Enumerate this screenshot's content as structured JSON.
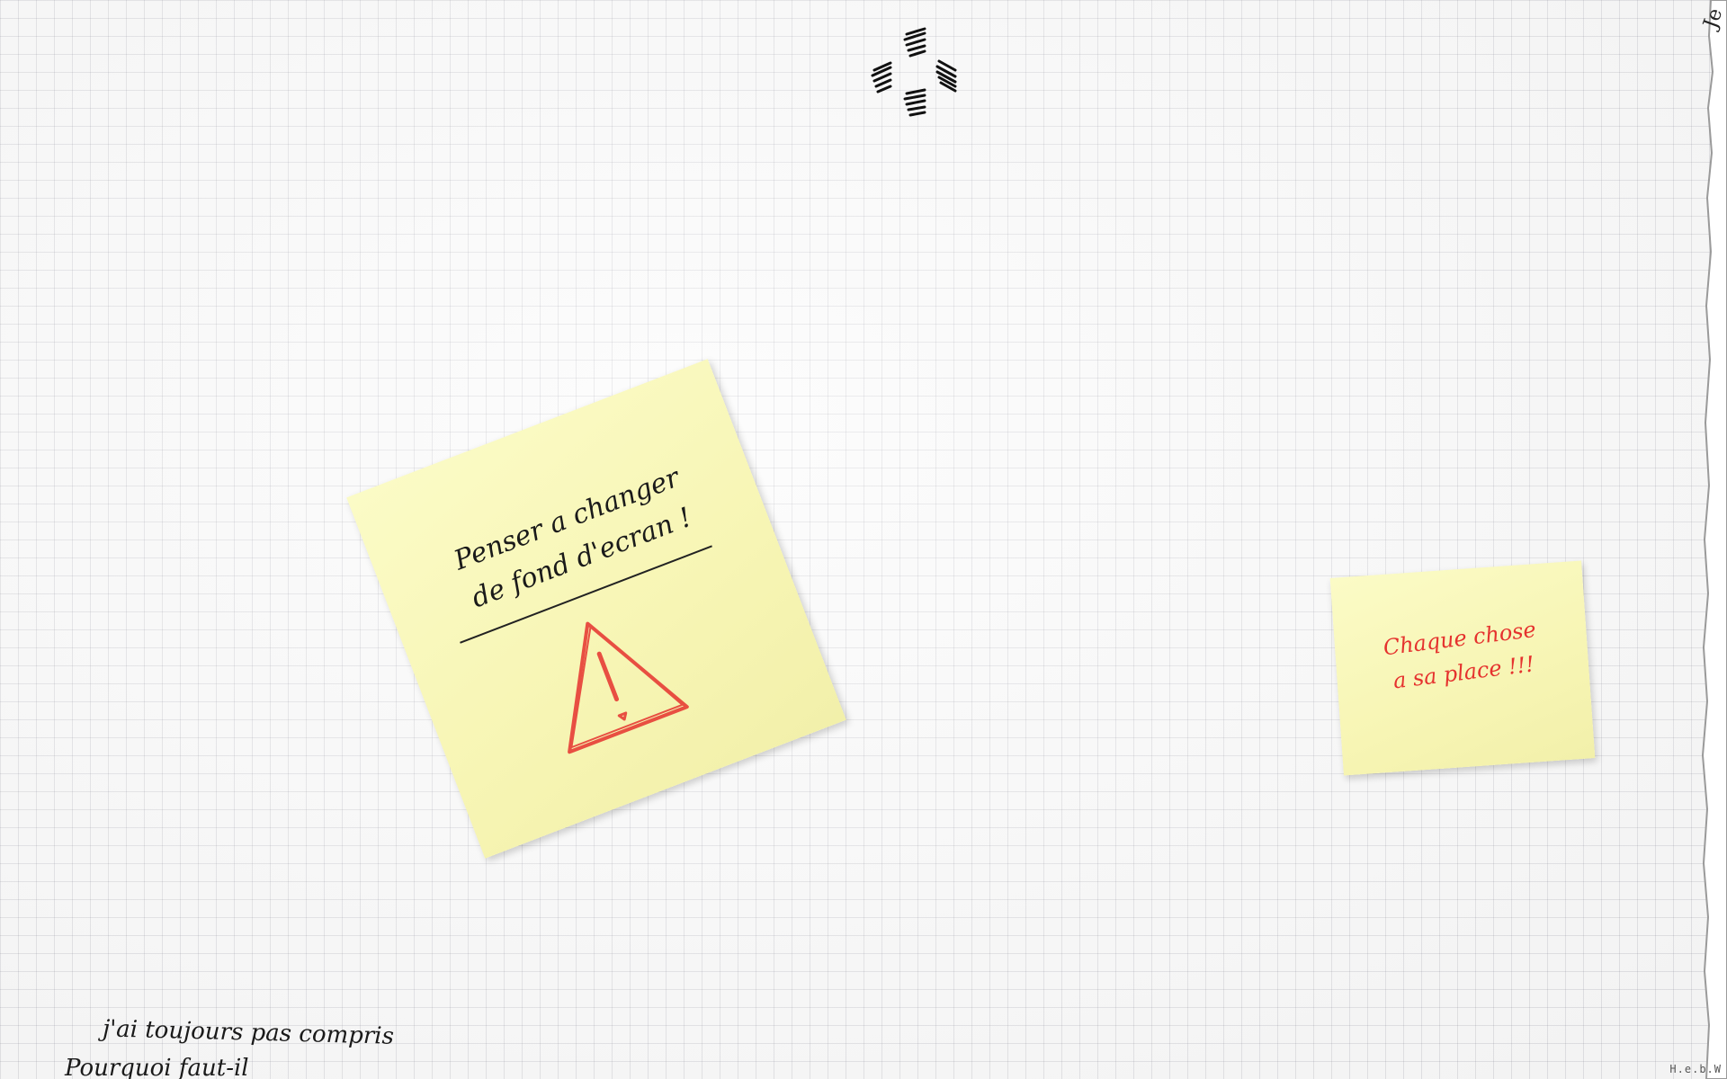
{
  "desktop": {
    "wallpaper": "graph-paper",
    "grid_color": "#c8c8d2",
    "background_color": "#fbfbfb"
  },
  "top_icons": {
    "icon": "scribbled-icon-cluster-icon"
  },
  "corner_mark": {
    "text": "Je"
  },
  "postit_main": {
    "line_1": "Penser a changer",
    "line_2": "de fond d'ecran !",
    "icon": "warning-triangle-icon",
    "icon_color": "#e5322e",
    "color": "#f7f5b4"
  },
  "postit_small": {
    "line_1": "Chaque chose",
    "line_2": "a sa place !!!",
    "text_color": "#e5322e",
    "color": "#f7f5b4"
  },
  "bottom_note": {
    "line_1": "j'ai toujours pas compris",
    "line_2": "Pourquoi faut-il"
  },
  "signature": {
    "text": "H.e.b.W"
  }
}
